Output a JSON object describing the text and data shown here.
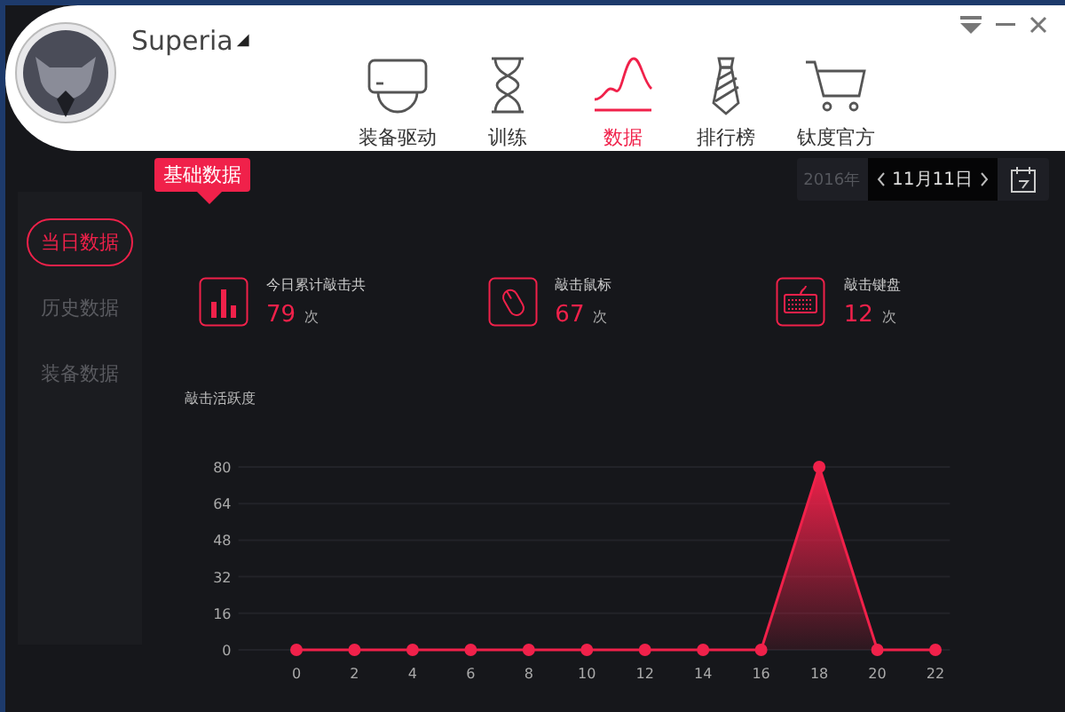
{
  "user": {
    "name": "Superia",
    "caret": "◢"
  },
  "nav": [
    {
      "label": "装备驱动",
      "selected": false
    },
    {
      "label": "训练",
      "selected": false
    },
    {
      "label": "数据",
      "selected": true
    },
    {
      "label": "排行榜",
      "selected": false
    },
    {
      "label": "钛度官方",
      "selected": false
    }
  ],
  "section_tag": "基础数据",
  "date": {
    "year": "2016年",
    "day": "11月11日"
  },
  "sidebar": {
    "items": [
      {
        "label": "当日数据",
        "selected": true
      },
      {
        "label": "历史数据",
        "selected": false
      },
      {
        "label": "装备数据",
        "selected": false
      }
    ]
  },
  "stats": [
    {
      "label": "今日累计敲击共",
      "value": "79",
      "unit": "次"
    },
    {
      "label": "敲击鼠标",
      "value": "67",
      "unit": "次"
    },
    {
      "label": "敲击键盘",
      "value": "12",
      "unit": "次"
    }
  ],
  "chart": {
    "chart_data": {
      "type": "area",
      "title": "敲击活跃度",
      "x": [
        0,
        2,
        4,
        6,
        8,
        10,
        12,
        14,
        16,
        18,
        20,
        22
      ],
      "series": [
        {
          "color": "#f0214a",
          "values": [
            0,
            0,
            0,
            0,
            0,
            0,
            0,
            0,
            0,
            80,
            0,
            0
          ]
        }
      ],
      "xlim": [
        -2,
        22.5
      ],
      "ylim": [
        0,
        80
      ],
      "grid": true,
      "yticks": [
        0,
        16,
        32,
        48,
        64,
        80
      ],
      "xticks": [
        0,
        2,
        4,
        6,
        8,
        10,
        12,
        14,
        16,
        18,
        20,
        22
      ]
    }
  }
}
